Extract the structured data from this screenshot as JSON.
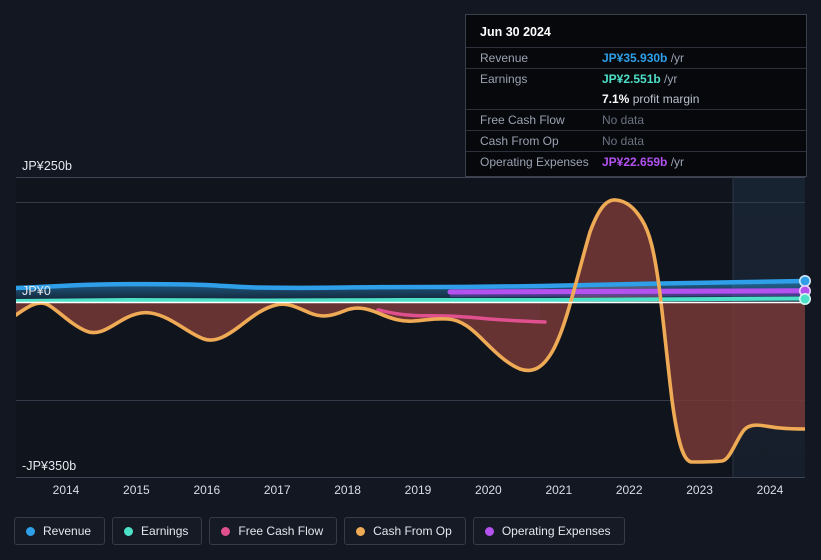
{
  "background": "#131722",
  "tooltip": {
    "date": "Jun 30 2024",
    "rows": [
      {
        "key": "Revenue",
        "value": "JP¥35.930b",
        "unit": "/yr",
        "color": "#2e9fe8",
        "nodata": false
      },
      {
        "key": "Earnings",
        "value": "JP¥2.551b",
        "unit": "/yr",
        "color": "#4de0c8",
        "nodata": false
      },
      {
        "key": "",
        "value": "7.1%",
        "unit": "profit margin",
        "color": "#ffffff",
        "nodata": false,
        "sub": true
      },
      {
        "key": "Free Cash Flow",
        "value": "No data",
        "unit": "",
        "color": "#6b7280",
        "nodata": true
      },
      {
        "key": "Cash From Op",
        "value": "No data",
        "unit": "",
        "color": "#6b7280",
        "nodata": true
      },
      {
        "key": "Operating Expenses",
        "value": "JP¥22.659b",
        "unit": "/yr",
        "color": "#b452f0",
        "nodata": false
      }
    ]
  },
  "legend": {
    "items": [
      {
        "label": "Revenue",
        "color": "#2e9fe8"
      },
      {
        "label": "Earnings",
        "color": "#4de0c8"
      },
      {
        "label": "Free Cash Flow",
        "color": "#e0508f"
      },
      {
        "label": "Cash From Op",
        "color": "#eeaa55"
      },
      {
        "label": "Operating Expenses",
        "color": "#b452f0"
      }
    ]
  },
  "axis": {
    "y_top_label": "JP¥250b",
    "y_zero_label": "JP¥0",
    "y_bottom_label": "-JP¥350b"
  },
  "chart_data": {
    "type": "area",
    "title": "",
    "xlabel": "",
    "ylabel": "JP¥ (billions)",
    "ylim": [
      -350,
      250
    ],
    "grid": true,
    "legend_position": "bottom",
    "currency": "JP¥",
    "units": "billions",
    "x_tick_labels": [
      "2014",
      "2015",
      "2016",
      "2017",
      "2018",
      "2019",
      "2020",
      "2021",
      "2022",
      "2023",
      "2024"
    ],
    "x": [
      2013.6,
      2014,
      2014.5,
      2015,
      2015.5,
      2016,
      2016.5,
      2017,
      2017.5,
      2018,
      2018.5,
      2019,
      2019.5,
      2020,
      2020.5,
      2021,
      2021.5,
      2022,
      2022.5,
      2023,
      2023.5,
      2024,
      2024.5
    ],
    "forecast_starts": 2023.3,
    "series": [
      {
        "name": "Revenue",
        "color": "#2e9fe8",
        "values": [
          22,
          24,
          26,
          27,
          28,
          27,
          26,
          25,
          26,
          28,
          28,
          27,
          26,
          25,
          26,
          28,
          30,
          32,
          33,
          34,
          35,
          35.93,
          35.93
        ],
        "last_value": 35.93,
        "last_label": "JP¥35.930b"
      },
      {
        "name": "Earnings",
        "color": "#4de0c8",
        "values": [
          1.0,
          1.4,
          1.8,
          2.0,
          2.2,
          2.0,
          1.8,
          1.6,
          1.8,
          2.2,
          2.4,
          2.3,
          2.1,
          1.9,
          2.0,
          2.2,
          2.4,
          2.5,
          2.5,
          2.5,
          2.5,
          2.551,
          2.551
        ],
        "last_value": 2.551,
        "last_label": "JP¥2.551b"
      },
      {
        "name": "Free Cash Flow",
        "color": "#e0508f",
        "values": [
          null,
          null,
          null,
          null,
          null,
          null,
          null,
          null,
          null,
          -6,
          -7,
          -8,
          -9,
          -10,
          -11,
          -12,
          -13,
          -14,
          -15,
          -15,
          -15,
          null,
          null
        ],
        "last_value": null,
        "last_label": "No data"
      },
      {
        "name": "Cash From Op",
        "color": "#eeaa55",
        "values": [
          -22,
          -10,
          -6,
          -8,
          -14,
          -22,
          -30,
          -24,
          -14,
          -9,
          -18,
          -14,
          -10,
          -30,
          -60,
          -85,
          40,
          250,
          230,
          -290,
          -290,
          -65,
          -65
        ],
        "last_value": null,
        "last_label": "No data"
      },
      {
        "name": "Operating Expenses",
        "color": "#b452f0",
        "values": [
          null,
          null,
          null,
          null,
          null,
          null,
          null,
          null,
          null,
          null,
          null,
          16,
          17,
          18,
          19,
          20,
          21,
          21.5,
          22,
          22.2,
          22.4,
          22.659,
          22.659
        ],
        "last_value": 22.659,
        "last_label": "JP¥22.659b"
      }
    ]
  }
}
